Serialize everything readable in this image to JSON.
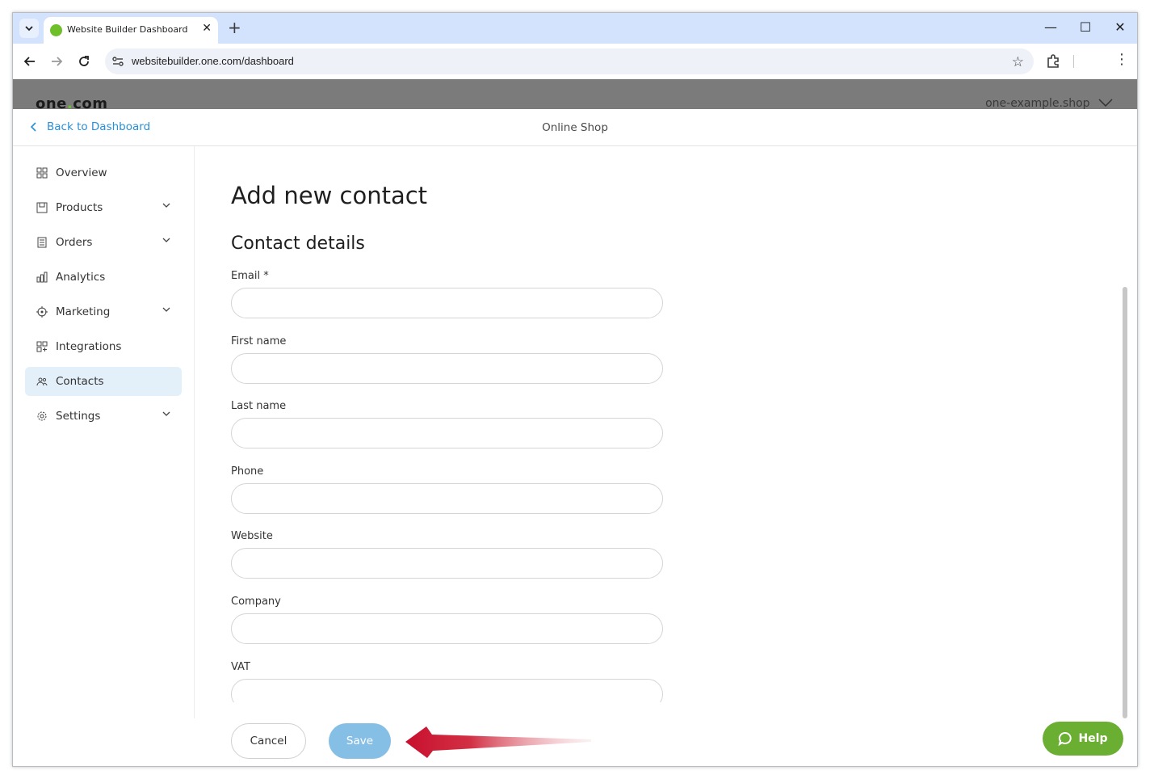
{
  "browser": {
    "tab_title": "Website Builder Dashboard",
    "tab_close": "✕",
    "new_tab": "+",
    "url": "websitebuilder.one.com/dashboard",
    "window_controls": {
      "minimize": "—",
      "maximize": "☐",
      "close": "✕"
    }
  },
  "header": {
    "logo_pre": "one",
    "logo_dot": ".",
    "logo_post": "com",
    "domain": "one-example.shop"
  },
  "subheader": {
    "back_label": "Back to Dashboard",
    "shop_title": "Online Shop"
  },
  "sidebar": {
    "items": [
      {
        "label": "Overview",
        "icon": "grid-icon",
        "has_chevron": false
      },
      {
        "label": "Products",
        "icon": "box-icon",
        "has_chevron": true
      },
      {
        "label": "Orders",
        "icon": "list-icon",
        "has_chevron": true
      },
      {
        "label": "Analytics",
        "icon": "bar-chart-icon",
        "has_chevron": false
      },
      {
        "label": "Marketing",
        "icon": "target-icon",
        "has_chevron": true
      },
      {
        "label": "Integrations",
        "icon": "grid-plus-icon",
        "has_chevron": false
      },
      {
        "label": "Contacts",
        "icon": "people-icon",
        "has_chevron": false,
        "active": true
      },
      {
        "label": "Settings",
        "icon": "gear-icon",
        "has_chevron": true
      }
    ]
  },
  "main": {
    "page_title": "Add new contact",
    "section_title": "Contact details",
    "fields": [
      {
        "label": "Email *",
        "value": ""
      },
      {
        "label": "First name",
        "value": ""
      },
      {
        "label": "Last name",
        "value": ""
      },
      {
        "label": "Phone",
        "value": ""
      },
      {
        "label": "Website",
        "value": ""
      },
      {
        "label": "Company",
        "value": ""
      },
      {
        "label": "VAT",
        "value": ""
      }
    ],
    "cancel_label": "Cancel",
    "save_label": "Save"
  },
  "help": {
    "label": "Help"
  },
  "colors": {
    "accent_blue": "#2a8fd6",
    "save_button": "#86bfe6",
    "help_green": "#6aae32",
    "active_item_bg": "#e3eff9",
    "annotation_arrow": "#c8102e"
  }
}
